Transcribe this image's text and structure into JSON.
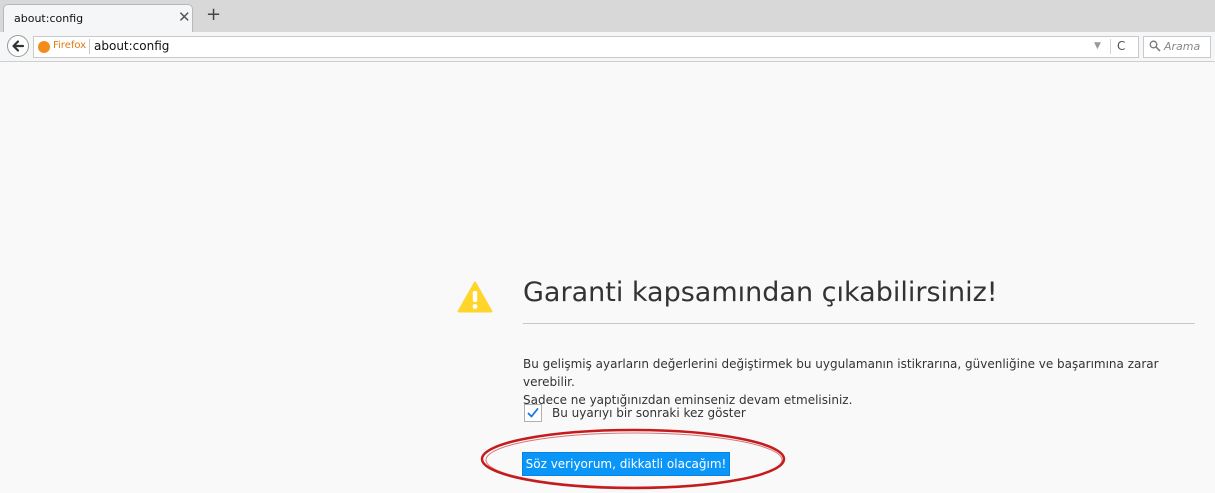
{
  "browser": {
    "tab": {
      "title": "about:config",
      "close_glyph": "✕"
    },
    "new_tab_glyph": "+",
    "urlbar": {
      "identity_label": "Firefox",
      "url": "about:config",
      "dropmarker_glyph": "▼",
      "reload_glyph": "C"
    },
    "search": {
      "placeholder": "Arama"
    }
  },
  "page": {
    "title": "Garanti kapsamından çıkabilirsiniz!",
    "description_line1": "Bu gelişmiş ayarların değerlerini değiştirmek bu uygulamanın istikrarına, güvenliğine ve başarımına zarar verebilir.",
    "description_line2": "Sadece ne yaptığınızdan eminseniz devam etmelisiniz.",
    "checkbox": {
      "label": "Bu uyarıyı bir sonraki kez göster",
      "checked": true
    },
    "accept_button": "Söz veriyorum, dikkatli olacağım!"
  },
  "colors": {
    "warning_icon": "#ffd52b",
    "accept_button": "#0996f8",
    "highlight_ellipse": "#c41c1c"
  }
}
